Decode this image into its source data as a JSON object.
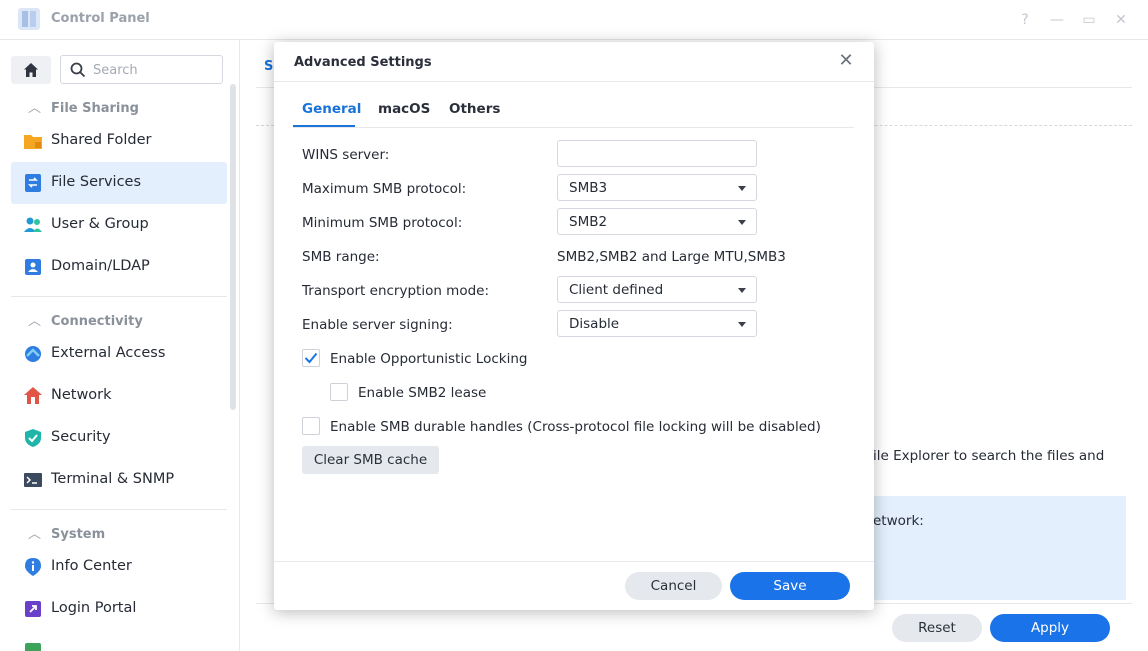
{
  "window": {
    "title": "Control Panel",
    "controls": {
      "help": "?",
      "minimize": "—",
      "maximize": "▭",
      "close": "✕"
    }
  },
  "sidebar": {
    "search_placeholder": "Search",
    "sections": [
      {
        "label": "File Sharing",
        "items": [
          "Shared Folder",
          "File Services",
          "User & Group",
          "Domain/LDAP"
        ]
      },
      {
        "label": "Connectivity",
        "items": [
          "External Access",
          "Network",
          "Security",
          "Terminal & SNMP"
        ]
      },
      {
        "label": "System",
        "items": [
          "Info Center",
          "Login Portal"
        ]
      }
    ],
    "active_item": "File Services"
  },
  "background_panel": {
    "tab_fragment": "S",
    "text_fragment": "ile Explorer to search the files and",
    "info_fragment": "etwork:",
    "reset_label": "Reset",
    "apply_label": "Apply"
  },
  "modal": {
    "title": "Advanced Settings",
    "close_glyph": "✕",
    "tabs": [
      "General",
      "macOS",
      "Others"
    ],
    "active_tab": "General",
    "fields": {
      "wins_server": {
        "label": "WINS server:",
        "value": ""
      },
      "max_smb": {
        "label": "Maximum SMB protocol:",
        "value": "SMB3"
      },
      "min_smb": {
        "label": "Minimum SMB protocol:",
        "value": "SMB2"
      },
      "smb_range": {
        "label": "SMB range:",
        "value": "SMB2,SMB2 and Large MTU,SMB3"
      },
      "transport_encryption": {
        "label": "Transport encryption mode:",
        "value": "Client defined"
      },
      "server_signing": {
        "label": "Enable server signing:",
        "value": "Disable"
      }
    },
    "checkboxes": {
      "opportunistic_locking": {
        "label": "Enable Opportunistic Locking",
        "checked": true
      },
      "smb2_lease": {
        "label": "Enable SMB2 lease",
        "checked": false
      },
      "durable_handles": {
        "label": "Enable SMB durable handles (Cross-protocol file locking will be disabled)",
        "checked": false
      }
    },
    "clear_cache_label": "Clear SMB cache",
    "cancel_label": "Cancel",
    "save_label": "Save"
  },
  "colors": {
    "accent": "#1a73e8",
    "active_nav_bg": "#e3effd",
    "button_grey": "#e5e8ec"
  }
}
